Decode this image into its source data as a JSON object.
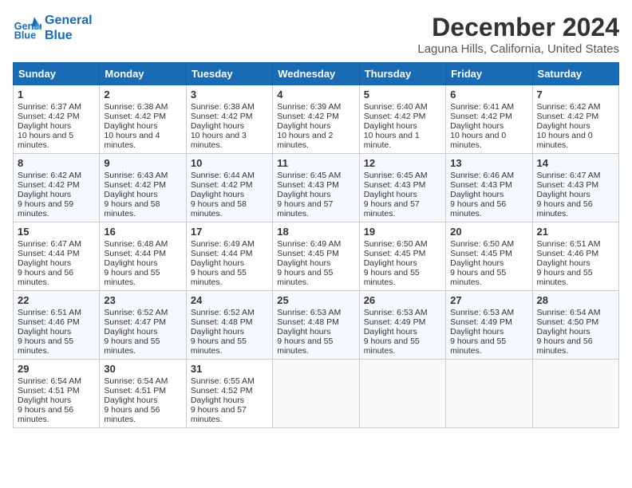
{
  "header": {
    "logo_line1": "General",
    "logo_line2": "Blue",
    "month_title": "December 2024",
    "location": "Laguna Hills, California, United States"
  },
  "weekdays": [
    "Sunday",
    "Monday",
    "Tuesday",
    "Wednesday",
    "Thursday",
    "Friday",
    "Saturday"
  ],
  "weeks": [
    [
      {
        "day": "1",
        "sunrise": "6:37 AM",
        "sunset": "4:42 PM",
        "daylight": "10 hours and 5 minutes."
      },
      {
        "day": "2",
        "sunrise": "6:38 AM",
        "sunset": "4:42 PM",
        "daylight": "10 hours and 4 minutes."
      },
      {
        "day": "3",
        "sunrise": "6:38 AM",
        "sunset": "4:42 PM",
        "daylight": "10 hours and 3 minutes."
      },
      {
        "day": "4",
        "sunrise": "6:39 AM",
        "sunset": "4:42 PM",
        "daylight": "10 hours and 2 minutes."
      },
      {
        "day": "5",
        "sunrise": "6:40 AM",
        "sunset": "4:42 PM",
        "daylight": "10 hours and 1 minute."
      },
      {
        "day": "6",
        "sunrise": "6:41 AM",
        "sunset": "4:42 PM",
        "daylight": "10 hours and 0 minutes."
      },
      {
        "day": "7",
        "sunrise": "6:42 AM",
        "sunset": "4:42 PM",
        "daylight": "10 hours and 0 minutes."
      }
    ],
    [
      {
        "day": "8",
        "sunrise": "6:42 AM",
        "sunset": "4:42 PM",
        "daylight": "9 hours and 59 minutes."
      },
      {
        "day": "9",
        "sunrise": "6:43 AM",
        "sunset": "4:42 PM",
        "daylight": "9 hours and 58 minutes."
      },
      {
        "day": "10",
        "sunrise": "6:44 AM",
        "sunset": "4:42 PM",
        "daylight": "9 hours and 58 minutes."
      },
      {
        "day": "11",
        "sunrise": "6:45 AM",
        "sunset": "4:43 PM",
        "daylight": "9 hours and 57 minutes."
      },
      {
        "day": "12",
        "sunrise": "6:45 AM",
        "sunset": "4:43 PM",
        "daylight": "9 hours and 57 minutes."
      },
      {
        "day": "13",
        "sunrise": "6:46 AM",
        "sunset": "4:43 PM",
        "daylight": "9 hours and 56 minutes."
      },
      {
        "day": "14",
        "sunrise": "6:47 AM",
        "sunset": "4:43 PM",
        "daylight": "9 hours and 56 minutes."
      }
    ],
    [
      {
        "day": "15",
        "sunrise": "6:47 AM",
        "sunset": "4:44 PM",
        "daylight": "9 hours and 56 minutes."
      },
      {
        "day": "16",
        "sunrise": "6:48 AM",
        "sunset": "4:44 PM",
        "daylight": "9 hours and 55 minutes."
      },
      {
        "day": "17",
        "sunrise": "6:49 AM",
        "sunset": "4:44 PM",
        "daylight": "9 hours and 55 minutes."
      },
      {
        "day": "18",
        "sunrise": "6:49 AM",
        "sunset": "4:45 PM",
        "daylight": "9 hours and 55 minutes."
      },
      {
        "day": "19",
        "sunrise": "6:50 AM",
        "sunset": "4:45 PM",
        "daylight": "9 hours and 55 minutes."
      },
      {
        "day": "20",
        "sunrise": "6:50 AM",
        "sunset": "4:45 PM",
        "daylight": "9 hours and 55 minutes."
      },
      {
        "day": "21",
        "sunrise": "6:51 AM",
        "sunset": "4:46 PM",
        "daylight": "9 hours and 55 minutes."
      }
    ],
    [
      {
        "day": "22",
        "sunrise": "6:51 AM",
        "sunset": "4:46 PM",
        "daylight": "9 hours and 55 minutes."
      },
      {
        "day": "23",
        "sunrise": "6:52 AM",
        "sunset": "4:47 PM",
        "daylight": "9 hours and 55 minutes."
      },
      {
        "day": "24",
        "sunrise": "6:52 AM",
        "sunset": "4:48 PM",
        "daylight": "9 hours and 55 minutes."
      },
      {
        "day": "25",
        "sunrise": "6:53 AM",
        "sunset": "4:48 PM",
        "daylight": "9 hours and 55 minutes."
      },
      {
        "day": "26",
        "sunrise": "6:53 AM",
        "sunset": "4:49 PM",
        "daylight": "9 hours and 55 minutes."
      },
      {
        "day": "27",
        "sunrise": "6:53 AM",
        "sunset": "4:49 PM",
        "daylight": "9 hours and 55 minutes."
      },
      {
        "day": "28",
        "sunrise": "6:54 AM",
        "sunset": "4:50 PM",
        "daylight": "9 hours and 56 minutes."
      }
    ],
    [
      {
        "day": "29",
        "sunrise": "6:54 AM",
        "sunset": "4:51 PM",
        "daylight": "9 hours and 56 minutes."
      },
      {
        "day": "30",
        "sunrise": "6:54 AM",
        "sunset": "4:51 PM",
        "daylight": "9 hours and 56 minutes."
      },
      {
        "day": "31",
        "sunrise": "6:55 AM",
        "sunset": "4:52 PM",
        "daylight": "9 hours and 57 minutes."
      },
      null,
      null,
      null,
      null
    ]
  ],
  "labels": {
    "sunrise": "Sunrise:",
    "sunset": "Sunset:",
    "daylight": "Daylight hours"
  }
}
